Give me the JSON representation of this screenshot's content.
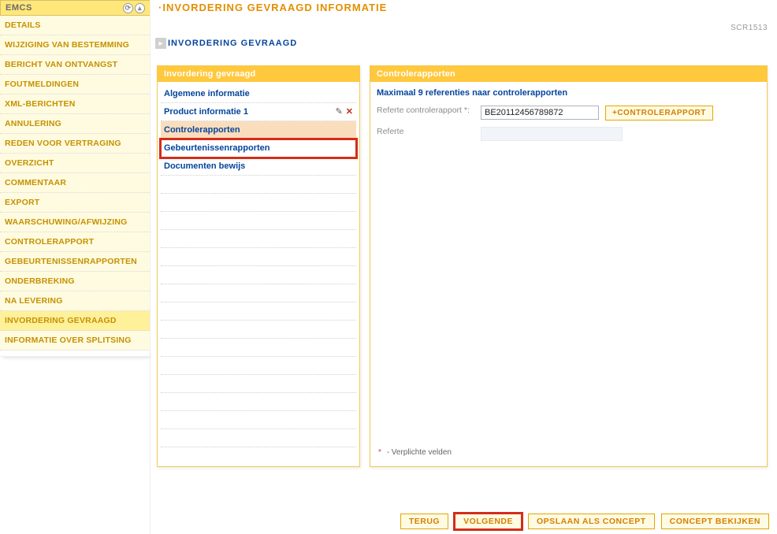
{
  "sidebar": {
    "title": "EMCS",
    "items": [
      {
        "label": "DETAILS"
      },
      {
        "label": "WIJZIGING VAN BESTEMMING"
      },
      {
        "label": "BERICHT VAN ONTVANGST"
      },
      {
        "label": "FOUTMELDINGEN"
      },
      {
        "label": "XML-BERICHTEN"
      },
      {
        "label": "ANNULERING"
      },
      {
        "label": "REDEN VOOR VERTRAGING"
      },
      {
        "label": "OVERZICHT"
      },
      {
        "label": "COMMENTAAR"
      },
      {
        "label": "EXPORT"
      },
      {
        "label": "WAARSCHUWING/AFWIJZING"
      },
      {
        "label": "CONTROLERAPPORT"
      },
      {
        "label": "GEBEURTENISSENRAPPORTEN"
      },
      {
        "label": "ONDERBREKING"
      },
      {
        "label": "NA LEVERING"
      },
      {
        "label": "INVORDERING GEVRAAGD",
        "active": true
      },
      {
        "label": "INFORMATIE OVER SPLITSING"
      }
    ]
  },
  "page": {
    "title": "·INVORDERING GEVRAAGD INFORMATIE",
    "screen_id": "SCR1513",
    "section": "INVORDERING GEVRAAGD"
  },
  "tree_panel": {
    "header": "Invordering gevraagd",
    "items": [
      {
        "label": "Algemene informatie"
      },
      {
        "label": "Product informatie 1",
        "has_actions": true
      },
      {
        "label": "Controlerapporten",
        "selected": true
      },
      {
        "label": "Gebeurtenissenrapporten",
        "highlight": true
      },
      {
        "label": "Documenten bewijs"
      }
    ]
  },
  "form_panel": {
    "header": "Controlerapporten",
    "heading": "Maximaal 9 referenties naar controlerapporten",
    "ref_label": "Referte controlerapport *:",
    "ref_value": "BE20112456789872",
    "add_button": "+CONTROLERAPPORT",
    "ref2_label": "Referte",
    "mandatory_note": "-  Verplichte velden"
  },
  "buttons": {
    "back": "TERUG",
    "next": "VOLGENDE",
    "save_draft": "OPSLAAN ALS CONCEPT",
    "view_draft": "CONCEPT BEKIJKEN"
  }
}
